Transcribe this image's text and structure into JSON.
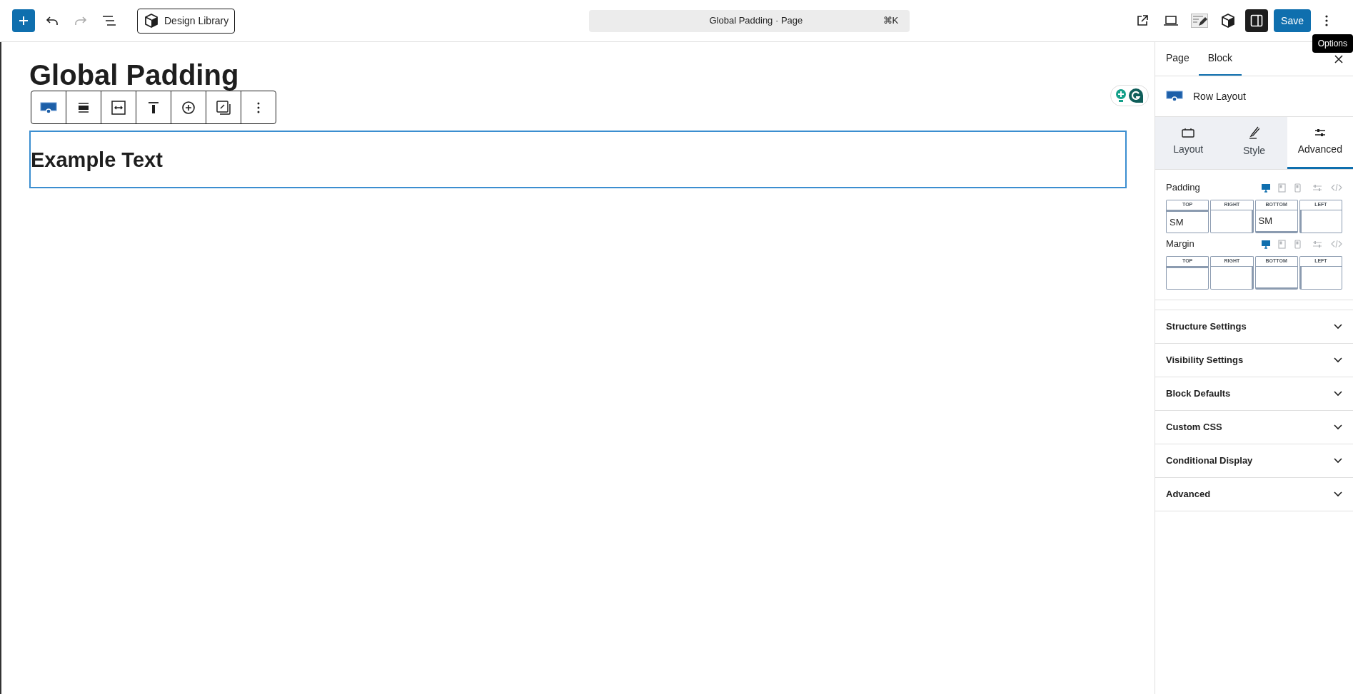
{
  "toolbar": {
    "library_button": "Design Library",
    "command_bar": {
      "title": "Global Padding · Page",
      "shortcut": "⌘K"
    },
    "sidebar_toggle": {
      "pressed": true
    },
    "save_button": "Save",
    "tooltip": "Options"
  },
  "canvas": {
    "title": "Global Padding",
    "block_text": "Example Text"
  },
  "sidebar": {
    "tabs": [
      {
        "label": "Page",
        "selected": false
      },
      {
        "label": "Block",
        "selected": true
      }
    ],
    "block_name": "Row Layout",
    "panel_tabs": [
      {
        "label": "Layout",
        "selected": false
      },
      {
        "label": "Style",
        "selected": false
      },
      {
        "label": "Advanced",
        "selected": true
      }
    ],
    "spacing": [
      {
        "label": "Padding",
        "devices": [
          {
            "selected": true
          },
          {
            "selected": false
          },
          {
            "selected": false
          }
        ],
        "sides": [
          {
            "label": "TOP",
            "value": "SM"
          },
          {
            "label": "RIGHT"
          },
          {
            "label": "BOTTOM",
            "value": "SM"
          },
          {
            "label": "LEFT"
          }
        ]
      },
      {
        "label": "Margin",
        "devices": [
          {
            "selected": true
          },
          {
            "selected": false
          },
          {
            "selected": false
          }
        ],
        "sides": [
          {
            "label": "TOP"
          },
          {
            "label": "RIGHT"
          },
          {
            "label": "BOTTOM"
          },
          {
            "label": "LEFT"
          }
        ]
      }
    ],
    "sections": [
      {
        "label": "Structure Settings",
        "expanded": false
      },
      {
        "label": "Visibility Settings",
        "expanded": false
      },
      {
        "label": "Block Defaults",
        "expanded": false
      },
      {
        "label": "Custom CSS",
        "expanded": false
      },
      {
        "label": "Conditional Display",
        "expanded": false
      },
      {
        "label": "Advanced",
        "expanded": false
      }
    ]
  }
}
